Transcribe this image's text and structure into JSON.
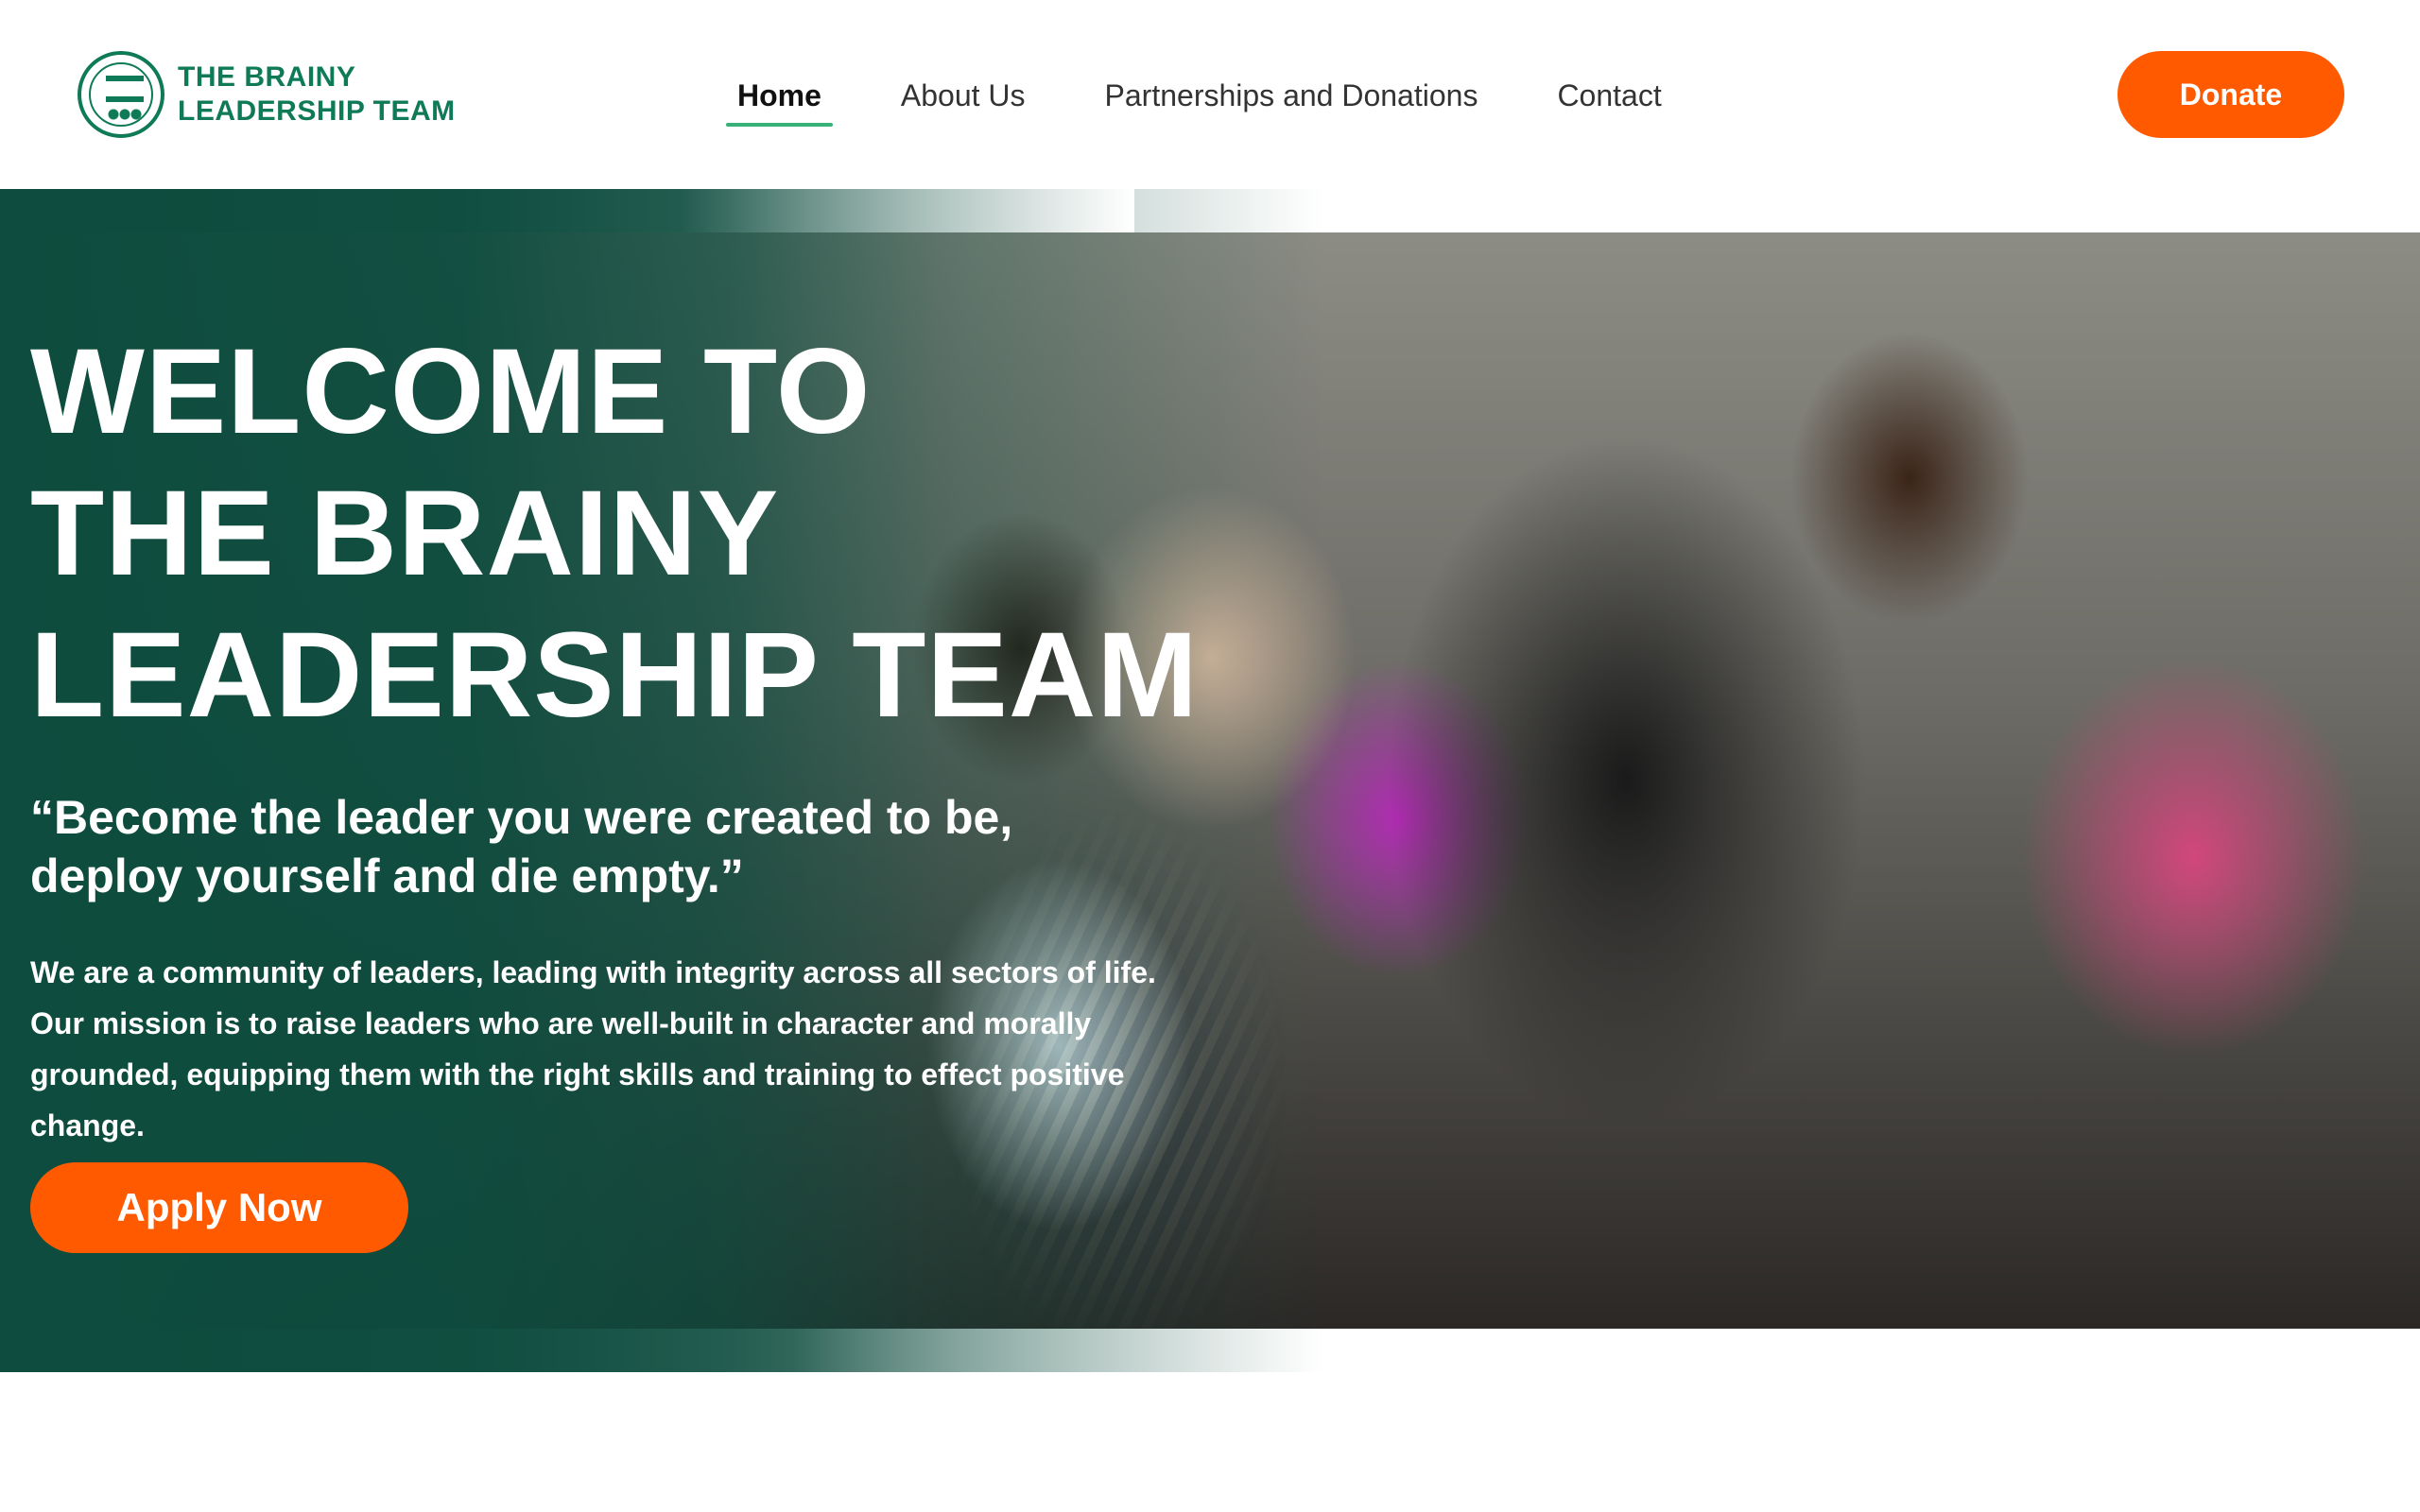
{
  "header": {
    "logo_line1": "THE BRAINY",
    "logo_line2": "LEADERSHIP TEAM",
    "nav": [
      {
        "label": "Home",
        "active": true
      },
      {
        "label": "About Us"
      },
      {
        "label": "Partnerships and Donations"
      },
      {
        "label": "Contact"
      }
    ],
    "donate_label": "Donate"
  },
  "hero": {
    "title_line1": "WELCOME TO",
    "title_line2": "THE BRAINY",
    "title_line3": "LEADERSHIP TEAM",
    "quote": "“Become the leader you were created to be, deploy yourself and die empty.”",
    "description": "We are a community of leaders, leading with integrity across all sectors of life. Our mission is to raise leaders who are well-built in character and morally grounded, equipping them with the right skills and training to effect positive change.",
    "cta_label": "Apply Now"
  },
  "colors": {
    "brand_green": "#0f7a57",
    "overlay_green": "#0d4c3e",
    "accent_orange": "#ff5a00",
    "nav_active_underline": "#39b27a"
  },
  "icons": {
    "logo": "brainy-leadership-logo-icon"
  }
}
